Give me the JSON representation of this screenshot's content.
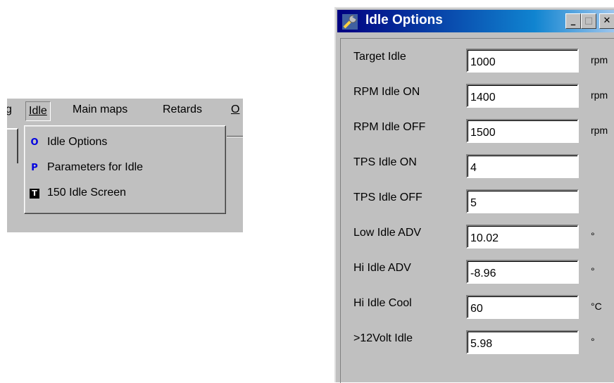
{
  "menubar": {
    "items": [
      "g",
      "Idle",
      "Main maps",
      "Retards",
      "O"
    ]
  },
  "dropdown": {
    "items": [
      {
        "icon": "O",
        "label": "Idle Options"
      },
      {
        "icon": "P",
        "label": "Parameters for Idle"
      },
      {
        "icon": "T",
        "label": "150 Idle Screen"
      }
    ]
  },
  "dialog": {
    "title": "Idle Options",
    "buttons": {
      "minimize": "_",
      "maximize": "□",
      "close": "✕"
    },
    "rows": [
      {
        "label": "Target Idle",
        "value": "1000",
        "unit": "rpm"
      },
      {
        "label": "RPM Idle ON",
        "value": "1400",
        "unit": "rpm"
      },
      {
        "label": "RPM Idle OFF",
        "value": "1500",
        "unit": "rpm"
      },
      {
        "label": "TPS Idle ON",
        "value": "4",
        "unit": ""
      },
      {
        "label": "TPS Idle OFF",
        "value": "5",
        "unit": ""
      },
      {
        "label": "Low Idle ADV",
        "value": "10.02",
        "unit": "°"
      },
      {
        "label": "Hi Idle ADV",
        "value": "-8.96",
        "unit": "°"
      },
      {
        "label": "Hi Idle Cool",
        "value": "60",
        "unit": "°C"
      },
      {
        "label": ">12Volt Idle",
        "value": "5.98",
        "unit": "°"
      }
    ]
  },
  "colors": {
    "face": "#c0c0c0",
    "titlebar_start": "#000080",
    "titlebar_end": "#a6caf0",
    "menu_icon_blue": "#0000e0"
  }
}
